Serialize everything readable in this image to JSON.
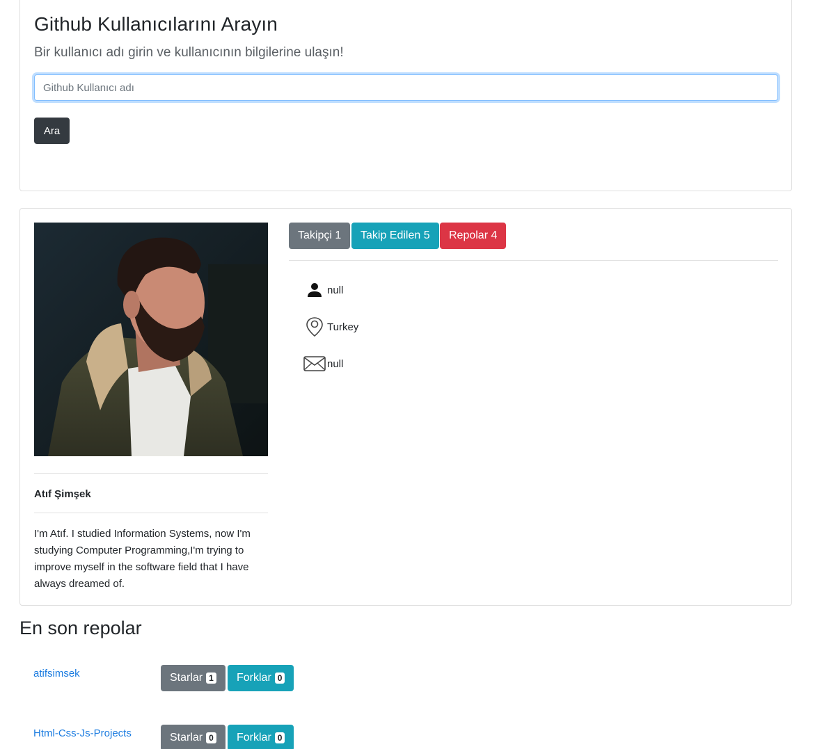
{
  "search": {
    "title": "Github Kullanıcılarını Arayın",
    "subtitle": "Bir kullanıcı adı girin ve kullanıcının bilgilerine ulaşın!",
    "placeholder": "Github Kullanıcı adı",
    "button_label": "Ara"
  },
  "profile": {
    "name": "Atıf Şimşek",
    "bio": "I'm Atıf. I studied Information Systems, now I'm studying Computer Programming,I'm trying to improve myself in the software field that I have always dreamed of.",
    "stats": {
      "followers": "Takipçi 1",
      "following": "Takip Edilen 5",
      "repos": "Repolar 4"
    },
    "info": {
      "company": "null",
      "location": "Turkey",
      "email": "null"
    }
  },
  "repos_section": {
    "title": "En son repolar",
    "items": [
      {
        "name": "atifsimsek",
        "stars_label": "Starlar",
        "stars": "1",
        "forks_label": "Forklar",
        "forks": "0"
      },
      {
        "name": "Html-Css-Js-Projects",
        "stars_label": "Starlar",
        "stars": "0",
        "forks_label": "Forklar",
        "forks": "0"
      }
    ]
  },
  "colors": {
    "dark": "#343a40",
    "gray": "#6c757d",
    "teal": "#17a2b8",
    "red": "#dc3545",
    "link": "#1a7be0"
  },
  "icons": {
    "company": "person-icon",
    "location": "map-pin-icon",
    "email": "envelope-icon"
  }
}
